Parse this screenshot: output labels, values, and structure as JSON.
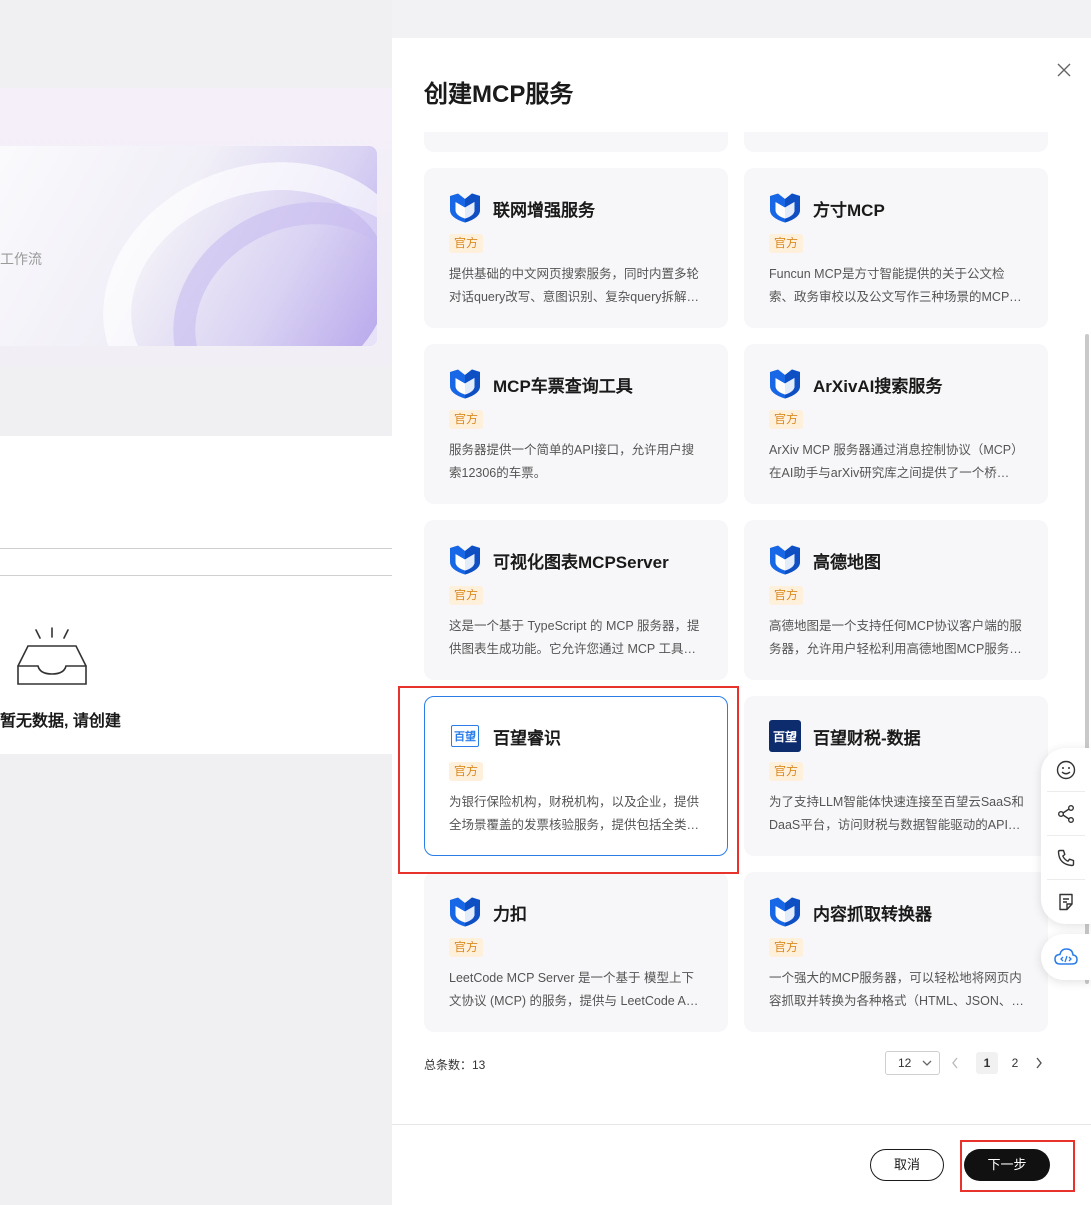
{
  "background": {
    "banner_text": "工作流",
    "empty_text": "暂无数据, 请创建"
  },
  "drawer": {
    "title": "创建MCP服务",
    "close_icon": "close-icon",
    "tag_label": "官方",
    "cards": [
      {
        "name": "联网增强服务",
        "tag": "官方",
        "logo": "blue-shield",
        "description": "提供基础的中文网页搜索服务，同时内置多轮对话query改写、意图识别、复杂query拆解、文..."
      },
      {
        "name": "方寸MCP",
        "tag": "官方",
        "logo": "blue-shield",
        "description": "Funcun MCP是方寸智能提供的关于公文检索、政务审校以及公文写作三种场景的MCP 服务。"
      },
      {
        "name": "MCP车票查询工具",
        "tag": "官方",
        "logo": "blue-shield",
        "description": "服务器提供一个简单的API接口，允许用户搜索12306的车票。"
      },
      {
        "name": "ArXivAI搜索服务",
        "tag": "官方",
        "logo": "blue-shield",
        "description": "ArXiv MCP 服务器通过消息控制协议（MCP）在AI助手与arXiv研究库之间提供了一个桥梁。..."
      },
      {
        "name": "可视化图表MCPServer",
        "tag": "官方",
        "logo": "blue-shield",
        "description": "这是一个基于 TypeScript 的 MCP 服务器，提供图表生成功能。它允许您通过 MCP 工具创建..."
      },
      {
        "name": "高德地图",
        "tag": "官方",
        "logo": "blue-shield",
        "description": "高德地图是一个支持任何MCP协议客户端的服务器，允许用户轻松利用高德地图MCP服务器..."
      },
      {
        "name": "百望睿识",
        "tag": "官方",
        "logo": "baiwang-logo",
        "logo_text": "百望",
        "description": "为银行保险机构，财税机构，以及企业，提供全场景覆盖的发票核验服务，提供包括全类型发..."
      },
      {
        "name": "百望财税-数据",
        "tag": "官方",
        "logo": "baiwang-dark-logo",
        "logo_text": "百望",
        "description": "为了支持LLM智能体快速连接至百望云SaaS和DaaS平台，访问财税与数据智能驱动的API服..."
      },
      {
        "name": "力扣",
        "tag": "官方",
        "logo": "blue-shield",
        "description": "LeetCode MCP Server 是一个基于 模型上下文协议 (MCP) 的服务，提供与 LeetCode API 的..."
      },
      {
        "name": "内容抓取转换器",
        "tag": "官方",
        "logo": "blue-shield",
        "description": "一个强大的MCP服务器，可以轻松地将网页内容抓取并转换为各种格式（HTML、JSON、M..."
      }
    ],
    "selected_index": 6,
    "pagination": {
      "total_label": "总条数：13",
      "page_size": "12",
      "pages": [
        "1",
        "2"
      ],
      "current_page": "1"
    },
    "footer": {
      "cancel_label": "取消",
      "next_label": "下一步"
    }
  },
  "floating_tools": [
    "smile-icon",
    "share-icon",
    "phone-icon",
    "notes-icon",
    "cloud-code-icon"
  ],
  "colors": {
    "tag_bg": "#fff0dc",
    "tag_text": "#d98a23",
    "selected_border": "#2b7de9",
    "highlight": "#e8322c",
    "shield_blue": "#1767e6"
  }
}
